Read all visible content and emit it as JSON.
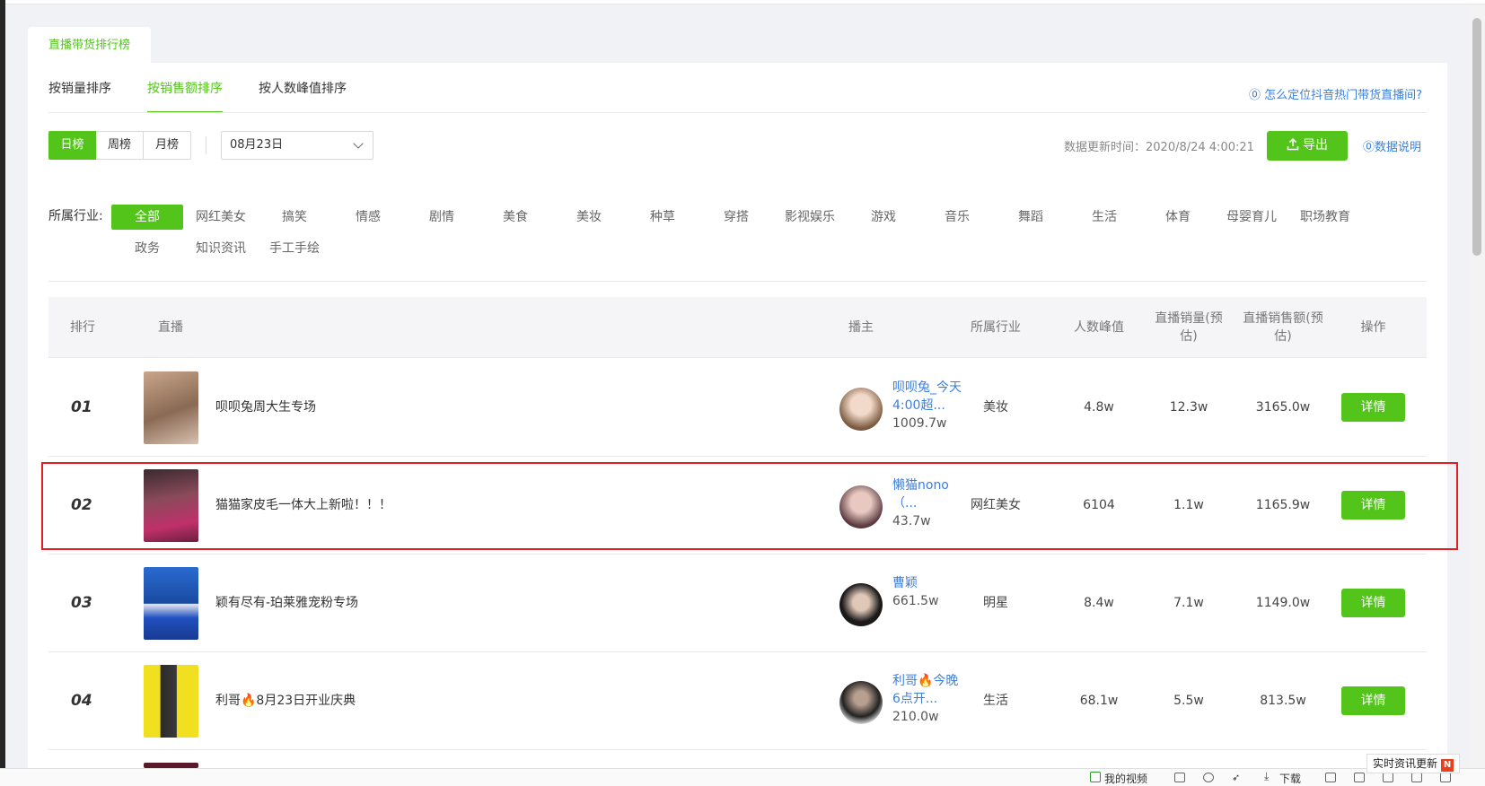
{
  "outer_tab": "直播带货排行榜",
  "sort_tabs": [
    "按销量排序",
    "按销售额排序",
    "按人数峰值排序"
  ],
  "help_link": "⓪ 怎么定位抖音热门带货直播间?",
  "periods": [
    "日榜",
    "周榜",
    "月榜"
  ],
  "date": "08月23日",
  "update_time": "数据更新时间：2020/8/24 4:00:21",
  "export_label": "导出",
  "data_note": "⓪数据说明",
  "industry_label": "所属行业:",
  "industries": [
    "全部",
    "网红美女",
    "搞笑",
    "情感",
    "剧情",
    "美食",
    "美妆",
    "种草",
    "穿搭",
    "影视娱乐",
    "游戏",
    "音乐",
    "舞蹈",
    "生活",
    "体育",
    "母婴育儿",
    "职场教育",
    "政务",
    "知识资讯",
    "手工手绘"
  ],
  "headers": {
    "rank": "排行",
    "live": "直播",
    "host": "播主",
    "industry": "所属行业",
    "peak": "人数峰值",
    "sales_volume": "直播销量(预估)",
    "sales_amount": "直播销售额(预估)",
    "action": "操作"
  },
  "rows": [
    {
      "rank": "01",
      "title": "呗呗兔周大生专场",
      "host_name": "呗呗兔_今天4:00超...",
      "host_fans": "1009.7w",
      "industry": "美妆",
      "peak": "4.8w",
      "volume": "12.3w",
      "amount": "3165.0w",
      "action": "详情"
    },
    {
      "rank": "02",
      "title": "猫猫家皮毛一体大上新啦！！！",
      "host_name": "懒猫nono（...",
      "host_fans": "43.7w",
      "industry": "网红美女",
      "peak": "6104",
      "volume": "1.1w",
      "amount": "1165.9w",
      "action": "详情"
    },
    {
      "rank": "03",
      "title": "颖有尽有-珀莱雅宠粉专场",
      "host_name": "曹颖",
      "host_fans": "661.5w",
      "industry": "明星",
      "peak": "8.4w",
      "volume": "7.1w",
      "amount": "1149.0w",
      "action": "详情"
    },
    {
      "rank": "04",
      "title": "利哥🔥8月23日开业庆典",
      "host_name": "利哥🔥今晚6点开...",
      "host_fans": "210.0w",
      "industry": "生活",
      "peak": "68.1w",
      "volume": "5.5w",
      "amount": "813.5w",
      "action": "详情"
    }
  ],
  "bottom_bar": {
    "video": "我的视频",
    "download": "下载"
  },
  "news_badge": "实时资讯更新",
  "news_badge_icon": "N",
  "colors": {
    "accent": "#52c41a",
    "link": "#3a7fe0",
    "highlight": "#e02020"
  }
}
